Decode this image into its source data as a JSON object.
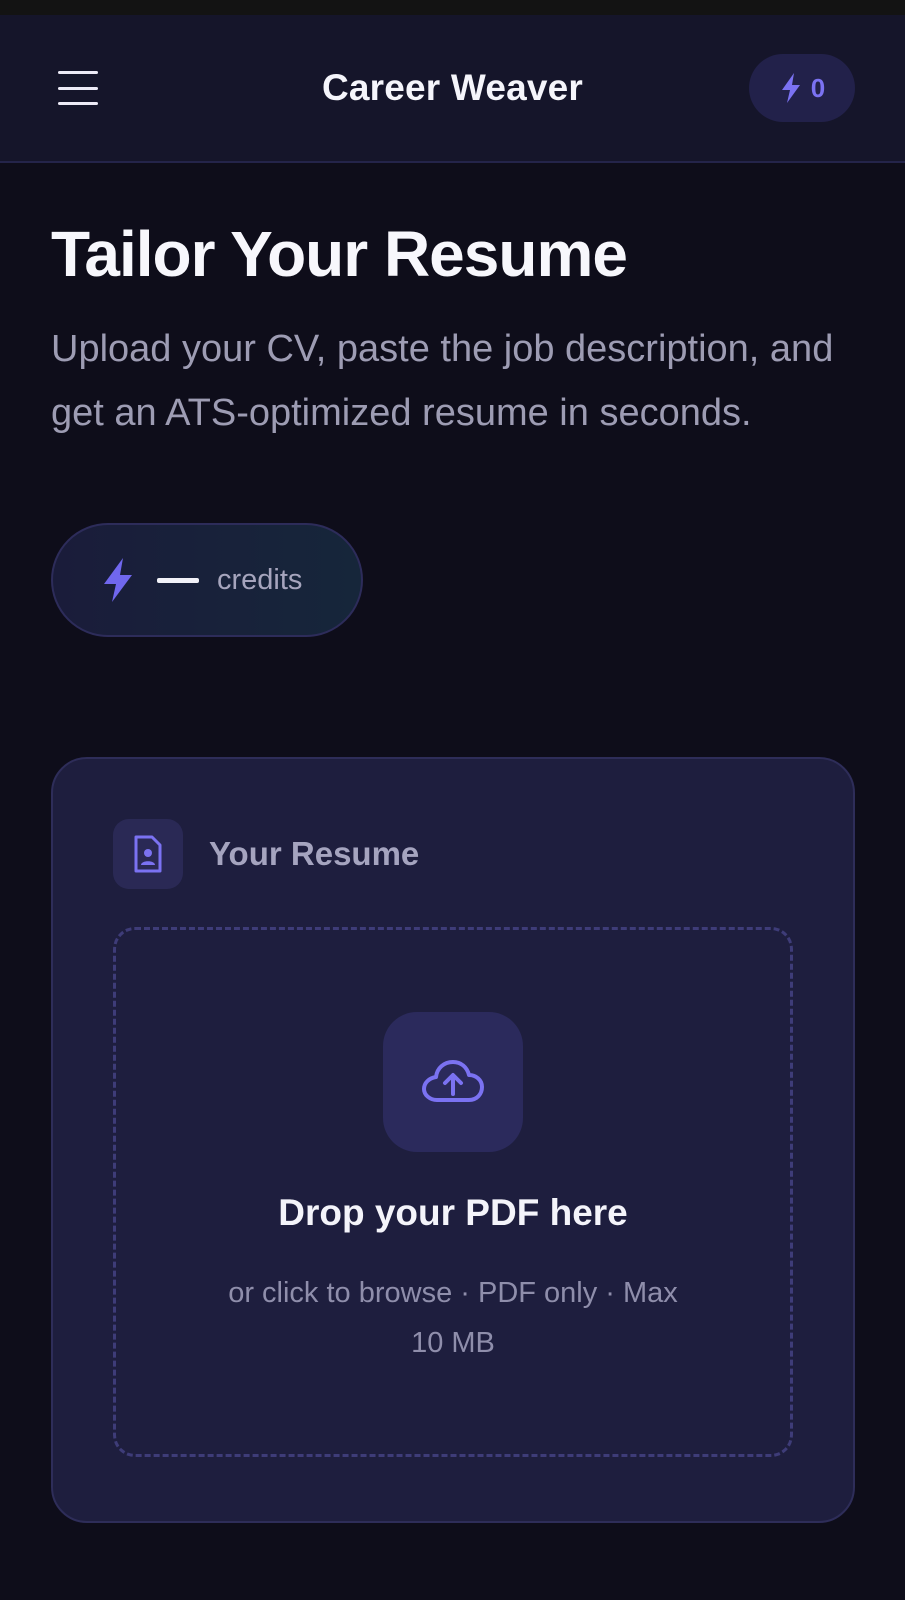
{
  "header": {
    "title": "Career Weaver",
    "credit_count": "0"
  },
  "hero": {
    "title": "Tailor Your Resume",
    "subtitle": "Upload your CV, paste the job description, and get an ATS-optimized resume in seconds."
  },
  "credits_badge": {
    "label": "credits"
  },
  "resume_card": {
    "title": "Your Resume",
    "dropzone": {
      "title": "Drop your PDF here",
      "hint": "or click to browse · PDF only · Max 10 MB"
    }
  },
  "colors": {
    "accent": "#7b72f2",
    "background": "#0e0d1a",
    "card": "#1e1e3e"
  }
}
